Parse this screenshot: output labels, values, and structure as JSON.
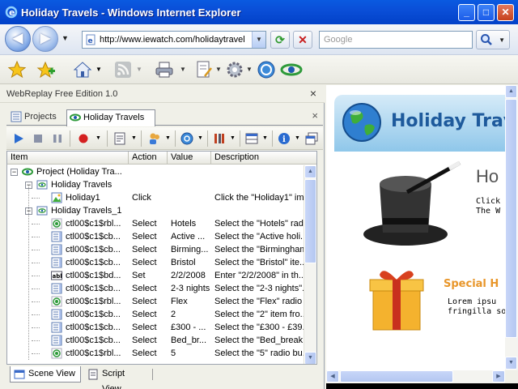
{
  "window": {
    "title": "Holiday Travels - Windows Internet Explorer",
    "minimize": "_",
    "maximize": "□",
    "close": "✕"
  },
  "navbar": {
    "url": "http://www.iewatch.com/holidaytravel",
    "search_placeholder": "Google"
  },
  "webreplay": {
    "title": "WebReplay Free Edition 1.0",
    "close": "×",
    "tabs": [
      {
        "label": "Projects"
      },
      {
        "label": "Holiday Travels"
      }
    ],
    "tab_close": "×",
    "columns": [
      "Item",
      "Action",
      "Value",
      "Description"
    ],
    "rows": [
      {
        "item": "Project (Holiday Tra...",
        "action": "",
        "value": "",
        "description": "",
        "icon": "project-icon"
      },
      {
        "item": "Holiday Travels",
        "action": "",
        "value": "",
        "description": "",
        "icon": "scene-icon"
      },
      {
        "item": "Holiday1",
        "action": "Click",
        "value": "",
        "description": "Click the \"Holiday1\" im...",
        "icon": "image-icon"
      },
      {
        "item": "Holiday Travels_1",
        "action": "",
        "value": "",
        "description": "",
        "icon": "scene-icon"
      },
      {
        "item": "ctl00$c1$rbl...",
        "action": "Select",
        "value": "Hotels",
        "description": "Select the \"Hotels\" rad...",
        "icon": "radio-icon"
      },
      {
        "item": "ctl00$c1$cb...",
        "action": "Select",
        "value": "Active ...",
        "description": "Select the \"Active holi...",
        "icon": "list-icon"
      },
      {
        "item": "ctl00$c1$cb...",
        "action": "Select",
        "value": "Birming...",
        "description": "Select the \"Birmingham...",
        "icon": "list-icon"
      },
      {
        "item": "ctl00$c1$cb...",
        "action": "Select",
        "value": "Bristol",
        "description": "Select the \"Bristol\" ite...",
        "icon": "list-icon"
      },
      {
        "item": "ctl00$c1$bd...",
        "action": "Set",
        "value": "2/2/2008",
        "description": "Enter \"2/2/2008\" in th...",
        "icon": "textbox-icon"
      },
      {
        "item": "ctl00$c1$cb...",
        "action": "Select",
        "value": "2-3 nights",
        "description": "Select the \"2-3 nights\"...",
        "icon": "list-icon"
      },
      {
        "item": "ctl00$c1$rbl...",
        "action": "Select",
        "value": "Flex",
        "description": "Select the \"Flex\" radio ...",
        "icon": "radio-icon"
      },
      {
        "item": "ctl00$c1$cb...",
        "action": "Select",
        "value": "2",
        "description": "Select the \"2\" item fro...",
        "icon": "list-icon"
      },
      {
        "item": "ctl00$c1$cb...",
        "action": "Select",
        "value": "£300 - ...",
        "description": "Select the \"£300 - £39...",
        "icon": "list-icon"
      },
      {
        "item": "ctl00$c1$cb...",
        "action": "Select",
        "value": "Bed_br...",
        "description": "Select the \"Bed_break...",
        "icon": "list-icon"
      },
      {
        "item": "ctl00$c1$rbl...",
        "action": "Select",
        "value": "5",
        "description": "Select the \"5\" radio bu...",
        "icon": "radio-icon"
      }
    ],
    "bottom_tabs": [
      {
        "label": "Scene View"
      },
      {
        "label": "Script View"
      }
    ]
  },
  "page": {
    "banner_title": "Holiday Travels",
    "heading_partial": "Ho",
    "click_line1": "Click",
    "click_line2": "The W",
    "special": "Special H",
    "lorem1": "Lorem ipsu",
    "lorem2": "fringilla soll"
  }
}
